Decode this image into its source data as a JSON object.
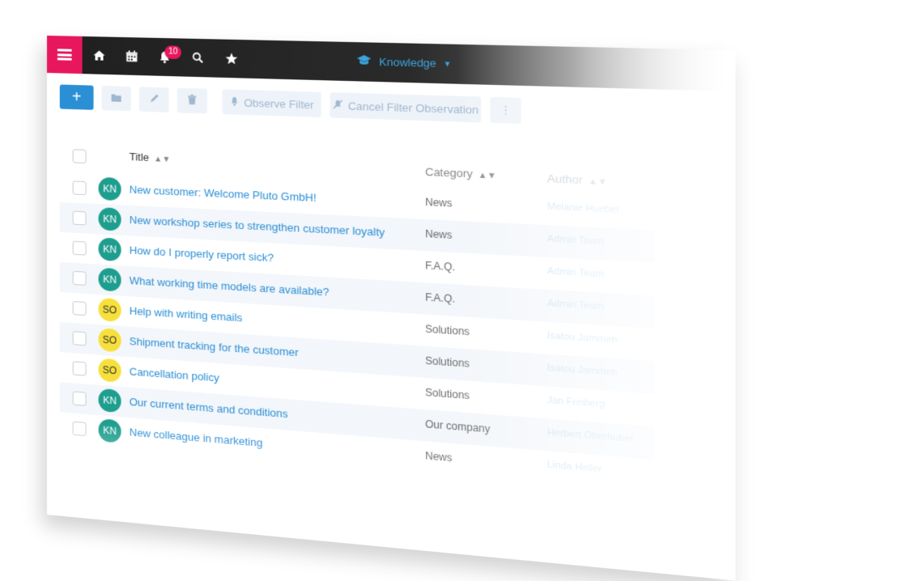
{
  "app": {
    "module_title": "Knowledge",
    "notification_count": "10"
  },
  "toolbar": {
    "add_label": "+",
    "observe_filter_label": "Observe Filter",
    "cancel_filter_label": "Cancel Filter Observation",
    "more_label": "⋮"
  },
  "table": {
    "columns": {
      "title": "Title",
      "category": "Category",
      "author": "Author"
    },
    "rows": [
      {
        "initials": "KN",
        "title": "New customer: Welcome Pluto GmbH!",
        "category": "News",
        "author": "Melanie Hueber"
      },
      {
        "initials": "KN",
        "title": "New workshop series to strengthen customer loyalty",
        "category": "News",
        "author": "Admin Team"
      },
      {
        "initials": "KN",
        "title": "How do I properly report sick?",
        "category": "F.A.Q.",
        "author": "Admin Team"
      },
      {
        "initials": "KN",
        "title": "What working time models are available?",
        "category": "F.A.Q.",
        "author": "Admin Team"
      },
      {
        "initials": "SO",
        "title": "Help with writing emails",
        "category": "Solutions",
        "author": "Isatou Jammeh"
      },
      {
        "initials": "SO",
        "title": "Shipment tracking for the customer",
        "category": "Solutions",
        "author": "Isatou Jammeh"
      },
      {
        "initials": "SO",
        "title": "Cancellation policy",
        "category": "Solutions",
        "author": "Jan Freiberg"
      },
      {
        "initials": "KN",
        "title": "Our current terms and conditions",
        "category": "Our company",
        "author": "Herbert Oberhuber"
      },
      {
        "initials": "KN",
        "title": "New colleague in marketing",
        "category": "News",
        "author": "Linda Heller"
      }
    ]
  },
  "colors": {
    "accent_pink": "#e8175d",
    "link_blue": "#2b8fd6",
    "avatar_kn": "#1e9e8e",
    "avatar_so": "#f7e03b"
  }
}
